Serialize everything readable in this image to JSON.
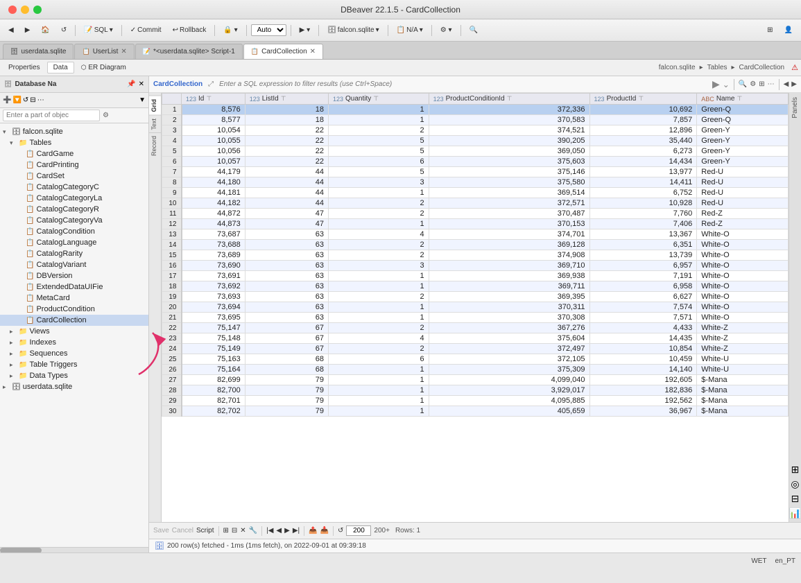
{
  "window": {
    "title": "DBeaver 22.1.5 - CardCollection",
    "os": "macOS"
  },
  "toolbar": {
    "commit": "Commit",
    "rollback": "Rollback",
    "auto": "Auto",
    "connection": "falcon.sqlite",
    "sql_label": "SQL",
    "na": "N/A"
  },
  "tabs": [
    {
      "id": "userdata",
      "label": "userdata.sqlite",
      "icon": "🗄",
      "closable": false,
      "active": false
    },
    {
      "id": "userlist",
      "label": "UserList",
      "icon": "📋",
      "closable": true,
      "active": false
    },
    {
      "id": "script1",
      "label": "*<userdata.sqlite> Script-1",
      "icon": "📝",
      "closable": false,
      "active": false
    },
    {
      "id": "cardcollection",
      "label": "CardCollection",
      "icon": "📋",
      "closable": true,
      "active": true
    }
  ],
  "sec_toolbar": {
    "properties": "Properties",
    "data": "Data",
    "er_diagram": "ER Diagram"
  },
  "breadcrumb": {
    "db": "falcon.sqlite",
    "section": "Tables",
    "table": "CardCollection"
  },
  "filter": {
    "placeholder": "Enter a SQL expression to filter results (use Ctrl+Space)"
  },
  "columns": [
    {
      "type": "123",
      "name": "Id"
    },
    {
      "type": "123",
      "name": "ListId"
    },
    {
      "type": "123",
      "name": "Quantity"
    },
    {
      "type": "123",
      "name": "ProductConditionId"
    },
    {
      "type": "123",
      "name": "ProductId"
    },
    {
      "type": "ABC",
      "name": "Name"
    }
  ],
  "rows": [
    {
      "num": 1,
      "id": 8576,
      "listId": 18,
      "qty": 1,
      "condId": 372336,
      "prodId": 10692,
      "name": "Green-Q",
      "selected": true
    },
    {
      "num": 2,
      "id": 8577,
      "listId": 18,
      "qty": 1,
      "condId": 370583,
      "prodId": 7857,
      "name": "Green-Q"
    },
    {
      "num": 3,
      "id": 10054,
      "listId": 22,
      "qty": 2,
      "condId": 374521,
      "prodId": 12896,
      "name": "Green-Y"
    },
    {
      "num": 4,
      "id": 10055,
      "listId": 22,
      "qty": 5,
      "condId": 390205,
      "prodId": 35440,
      "name": "Green-Y"
    },
    {
      "num": 5,
      "id": 10056,
      "listId": 22,
      "qty": 5,
      "condId": 369050,
      "prodId": 6273,
      "name": "Green-Y"
    },
    {
      "num": 6,
      "id": 10057,
      "listId": 22,
      "qty": 6,
      "condId": 375603,
      "prodId": 14434,
      "name": "Green-Y"
    },
    {
      "num": 7,
      "id": 44179,
      "listId": 44,
      "qty": 5,
      "condId": 375146,
      "prodId": 13977,
      "name": "Red-U"
    },
    {
      "num": 8,
      "id": 44180,
      "listId": 44,
      "qty": 3,
      "condId": 375580,
      "prodId": 14411,
      "name": "Red-U"
    },
    {
      "num": 9,
      "id": 44181,
      "listId": 44,
      "qty": 1,
      "condId": 369514,
      "prodId": 6752,
      "name": "Red-U"
    },
    {
      "num": 10,
      "id": 44182,
      "listId": 44,
      "qty": 2,
      "condId": 372571,
      "prodId": 10928,
      "name": "Red-U"
    },
    {
      "num": 11,
      "id": 44872,
      "listId": 47,
      "qty": 2,
      "condId": 370487,
      "prodId": 7760,
      "name": "Red-Z"
    },
    {
      "num": 12,
      "id": 44873,
      "listId": 47,
      "qty": 1,
      "condId": 370153,
      "prodId": 7406,
      "name": "Red-Z"
    },
    {
      "num": 13,
      "id": 73687,
      "listId": 63,
      "qty": 4,
      "condId": 374701,
      "prodId": 13367,
      "name": "White-O"
    },
    {
      "num": 14,
      "id": 73688,
      "listId": 63,
      "qty": 2,
      "condId": 369128,
      "prodId": 6351,
      "name": "White-O"
    },
    {
      "num": 15,
      "id": 73689,
      "listId": 63,
      "qty": 2,
      "condId": 374908,
      "prodId": 13739,
      "name": "White-O"
    },
    {
      "num": 16,
      "id": 73690,
      "listId": 63,
      "qty": 3,
      "condId": 369710,
      "prodId": 6957,
      "name": "White-O"
    },
    {
      "num": 17,
      "id": 73691,
      "listId": 63,
      "qty": 1,
      "condId": 369938,
      "prodId": 7191,
      "name": "White-O"
    },
    {
      "num": 18,
      "id": 73692,
      "listId": 63,
      "qty": 1,
      "condId": 369711,
      "prodId": 6958,
      "name": "White-O"
    },
    {
      "num": 19,
      "id": 73693,
      "listId": 63,
      "qty": 2,
      "condId": 369395,
      "prodId": 6627,
      "name": "White-O"
    },
    {
      "num": 20,
      "id": 73694,
      "listId": 63,
      "qty": 1,
      "condId": 370311,
      "prodId": 7574,
      "name": "White-O"
    },
    {
      "num": 21,
      "id": 73695,
      "listId": 63,
      "qty": 1,
      "condId": 370308,
      "prodId": 7571,
      "name": "White-O"
    },
    {
      "num": 22,
      "id": 75147,
      "listId": 67,
      "qty": 2,
      "condId": 367276,
      "prodId": 4433,
      "name": "White-Z"
    },
    {
      "num": 23,
      "id": 75148,
      "listId": 67,
      "qty": 4,
      "condId": 375604,
      "prodId": 14435,
      "name": "White-Z"
    },
    {
      "num": 24,
      "id": 75149,
      "listId": 67,
      "qty": 2,
      "condId": 372497,
      "prodId": 10854,
      "name": "White-Z"
    },
    {
      "num": 25,
      "id": 75163,
      "listId": 68,
      "qty": 6,
      "condId": 372105,
      "prodId": 10459,
      "name": "White-U"
    },
    {
      "num": 26,
      "id": 75164,
      "listId": 68,
      "qty": 1,
      "condId": 375309,
      "prodId": 14140,
      "name": "White-U"
    },
    {
      "num": 27,
      "id": 82699,
      "listId": 79,
      "qty": 1,
      "condId": 4099040,
      "prodId": 192605,
      "name": "$-Mana"
    },
    {
      "num": 28,
      "id": 82700,
      "listId": 79,
      "qty": 1,
      "condId": 3929017,
      "prodId": 182836,
      "name": "$-Mana"
    },
    {
      "num": 29,
      "id": 82701,
      "listId": 79,
      "qty": 1,
      "condId": 4095885,
      "prodId": 192562,
      "name": "$-Mana"
    },
    {
      "num": 30,
      "id": 82702,
      "listId": 79,
      "qty": 1,
      "condId": 405659,
      "prodId": 36967,
      "name": "$-Mana"
    }
  ],
  "sidebar": {
    "title": "Database Na",
    "connection": "falcon.sqlite",
    "items": [
      {
        "label": "falcon.sqlite",
        "level": 0,
        "type": "db",
        "expanded": true
      },
      {
        "label": "Tables",
        "level": 1,
        "type": "folder",
        "expanded": true
      },
      {
        "label": "CardGame",
        "level": 2,
        "type": "table"
      },
      {
        "label": "CardPrinting",
        "level": 2,
        "type": "table"
      },
      {
        "label": "CardSet",
        "level": 2,
        "type": "table"
      },
      {
        "label": "CatalogCategoryC",
        "level": 2,
        "type": "table"
      },
      {
        "label": "CatalogCategoryLa",
        "level": 2,
        "type": "table"
      },
      {
        "label": "CatalogCategoryR",
        "level": 2,
        "type": "table"
      },
      {
        "label": "CatalogCategoryVa",
        "level": 2,
        "type": "table"
      },
      {
        "label": "CatalogCondition",
        "level": 2,
        "type": "table"
      },
      {
        "label": "CatalogLanguage",
        "level": 2,
        "type": "table"
      },
      {
        "label": "CatalogRarity",
        "level": 2,
        "type": "table"
      },
      {
        "label": "CatalogVariant",
        "level": 2,
        "type": "table"
      },
      {
        "label": "DBVersion",
        "level": 2,
        "type": "table"
      },
      {
        "label": "ExtendedDataUIFie",
        "level": 2,
        "type": "table"
      },
      {
        "label": "MetaCard",
        "level": 2,
        "type": "table"
      },
      {
        "label": "ProductCondition",
        "level": 2,
        "type": "table"
      },
      {
        "label": "CardCollection",
        "level": 2,
        "type": "table",
        "selected": true
      },
      {
        "label": "Views",
        "level": 1,
        "type": "folder",
        "expanded": false
      },
      {
        "label": "Indexes",
        "level": 1,
        "type": "folder",
        "expanded": false
      },
      {
        "label": "Sequences",
        "level": 1,
        "type": "folder",
        "expanded": false
      },
      {
        "label": "Table Triggers",
        "level": 1,
        "type": "folder",
        "expanded": false
      },
      {
        "label": "Data Types",
        "level": 1,
        "type": "folder",
        "expanded": false
      },
      {
        "label": "userdata.sqlite",
        "level": 0,
        "type": "db",
        "expanded": false
      }
    ]
  },
  "bottom": {
    "save": "Save",
    "cancel": "Cancel",
    "script": "Script",
    "row_count": "200",
    "rows_label": "200+",
    "rows_info": "Rows: 1",
    "status_msg": "200 row(s) fetched - 1ms (1ms fetch), on 2022-09-01 at 09:39:18"
  },
  "status": {
    "encoding": "WET",
    "locale": "en_PT"
  },
  "left_tabs": [
    "Grid",
    "Text",
    "Record"
  ],
  "panels_label": "Panels"
}
